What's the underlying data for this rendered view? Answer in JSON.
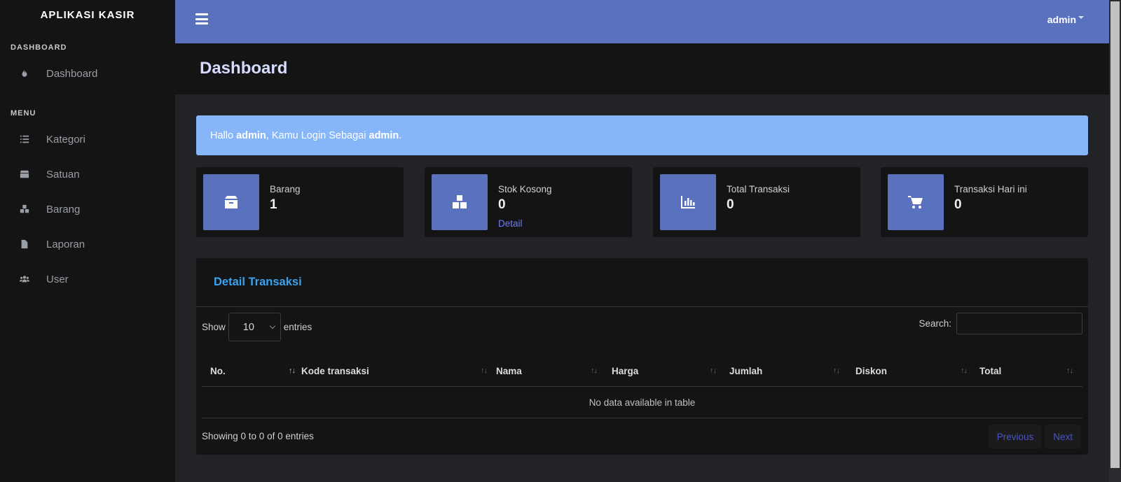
{
  "app": {
    "brand": "APLIKASI KASIR"
  },
  "sidebar": {
    "sections": [
      {
        "header": "DASHBOARD"
      },
      {
        "header": "MENU"
      }
    ],
    "items": [
      {
        "label": "Dashboard",
        "icon": "fire-icon"
      },
      {
        "label": "Kategori",
        "icon": "list-icon"
      },
      {
        "label": "Satuan",
        "icon": "box-icon"
      },
      {
        "label": "Barang",
        "icon": "boxes-icon"
      },
      {
        "label": "Laporan",
        "icon": "file-icon"
      },
      {
        "label": "User",
        "icon": "users-icon"
      }
    ]
  },
  "topbar": {
    "user": "admin",
    "accent_color": "#5a71bd"
  },
  "page": {
    "title": "Dashboard"
  },
  "alert": {
    "prefix": "Hallo ",
    "name": "admin",
    "middle": ", Kamu Login Sebagai ",
    "role": "admin",
    "suffix": "."
  },
  "stats": [
    {
      "label": "Barang",
      "value": "1",
      "icon": "box-open-icon"
    },
    {
      "label": "Stok Kosong",
      "value": "0",
      "link": "Detail",
      "icon": "boxes-icon"
    },
    {
      "label": "Total Transaksi",
      "value": "0",
      "icon": "chart-bar-icon"
    },
    {
      "label": "Transaksi Hari ini",
      "value": "0",
      "icon": "shopping-cart-icon"
    }
  ],
  "transactions": {
    "title": "Detail Transaksi",
    "show_label": "Show",
    "entries_label": "entries",
    "page_length": "10",
    "search_label": "Search:",
    "search_value": "",
    "columns": [
      "No.",
      "Kode transaksi",
      "Nama",
      "Harga",
      "Jumlah",
      "Diskon",
      "Total"
    ],
    "empty_message": "No data available in table",
    "info": "Showing 0 to 0 of 0 entries",
    "prev_label": "Previous",
    "next_label": "Next"
  }
}
